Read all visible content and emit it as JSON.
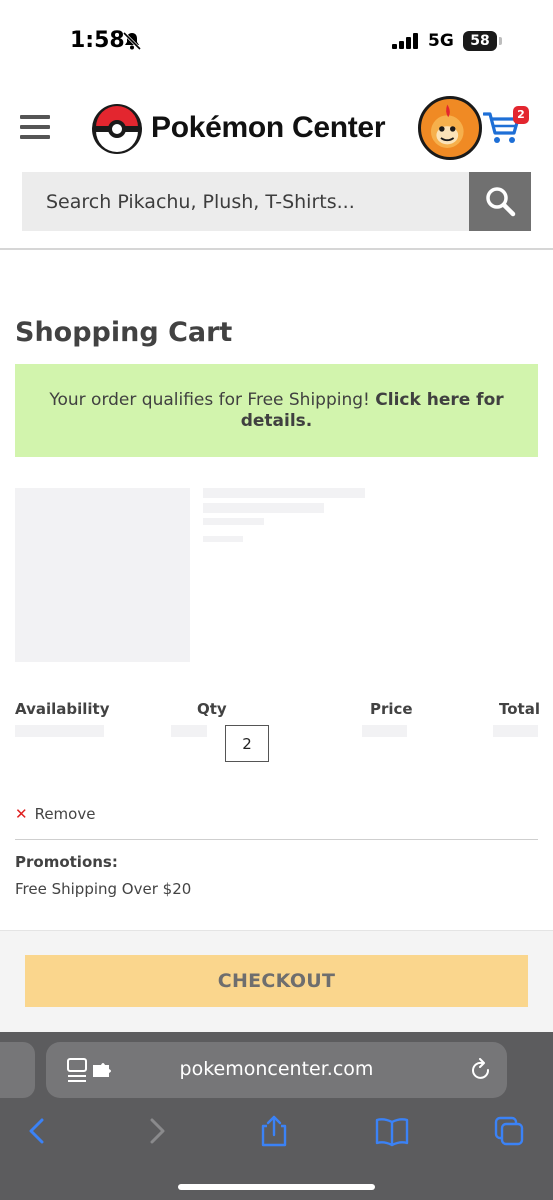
{
  "status_bar": {
    "time": "1:58",
    "network": "5G",
    "battery": "58"
  },
  "header": {
    "logo_text": "Pokémon Center",
    "cart_count": "2",
    "search": {
      "placeholder": "Search Pikachu, Plush, T-Shirts..."
    }
  },
  "cart": {
    "title": "Shopping Cart",
    "banner": {
      "message": "Your order qualifies for Free Shipping!",
      "link": "Click here for details."
    },
    "columns": {
      "availability": "Availability",
      "qty": "Qty",
      "price": "Price",
      "total": "Total"
    },
    "quantity": "2",
    "remove_label": "Remove",
    "promotions_heading": "Promotions:",
    "promotion": "Free Shipping Over $20",
    "checkout_label": "CHECKOUT"
  },
  "browser": {
    "url": "pokemoncenter.com"
  },
  "colors": {
    "banner_bg": "#d2f4ad",
    "checkout_bg": "#fad68d",
    "cart_blue": "#1e6fd6",
    "badge_red": "#e3262f",
    "safari_accent": "#3b82f6"
  },
  "icons": {
    "menu": "hamburger-menu-icon",
    "logo": "pokeball-icon",
    "cart": "shopping-cart-icon",
    "search": "magnifier-icon",
    "remove": "x-icon",
    "reader": "reader-mode-icon",
    "reload": "reload-icon",
    "back": "chevron-left-icon",
    "forward": "chevron-right-icon",
    "share": "share-icon",
    "bookmarks": "book-icon",
    "tabs": "tabs-icon"
  }
}
